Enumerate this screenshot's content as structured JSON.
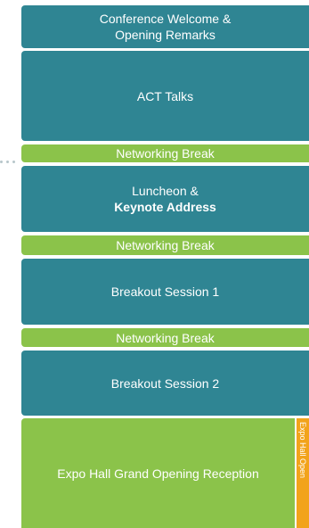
{
  "schedule": {
    "welcome": {
      "line1": "Conference Welcome &",
      "line2": "Opening Remarks"
    },
    "act_talks": "ACT Talks",
    "break1": "Networking Break",
    "luncheon": {
      "line1": "Luncheon &",
      "line2": "Keynote Address"
    },
    "break2": "Networking Break",
    "breakout1": "Breakout Session 1",
    "break3": "Networking Break",
    "breakout2": "Breakout Session 2",
    "expo_reception": "Expo Hall Grand Opening Reception",
    "expo_open_tab": "Expo Hall Open"
  },
  "colors": {
    "session": "#2f8593",
    "break": "#8bc34a",
    "expo_tab": "#f2a31b",
    "timeline_dots": "#b7c6ca"
  }
}
